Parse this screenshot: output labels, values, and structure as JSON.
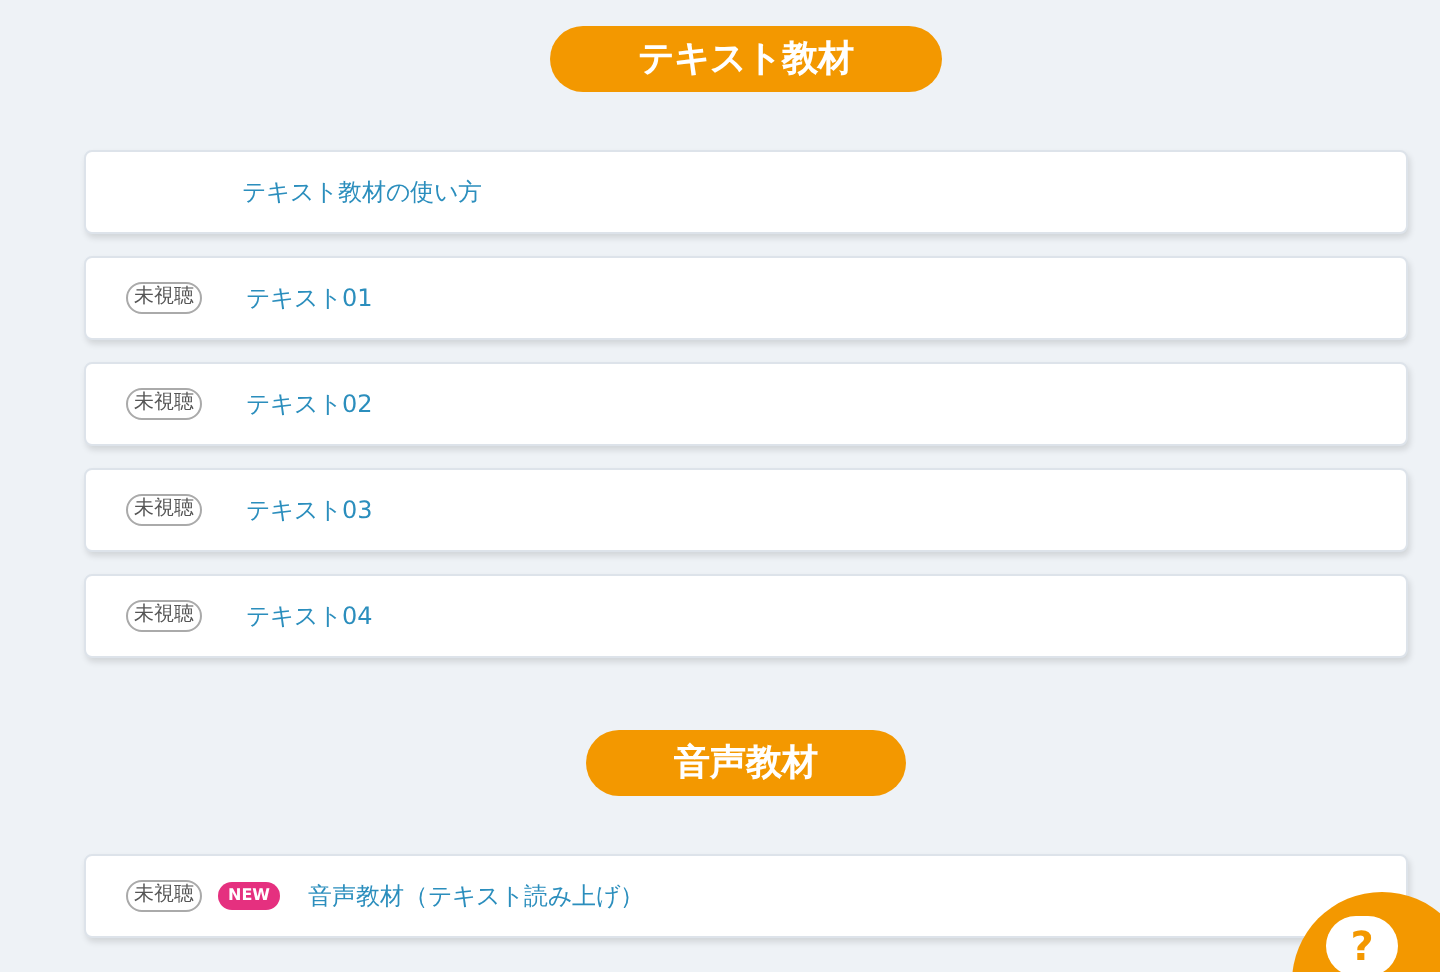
{
  "sections": [
    {
      "title": "テキスト教材",
      "items": [
        {
          "title": "テキスト教材の使い方"
        },
        {
          "status": "未視聴",
          "title": "テキスト01"
        },
        {
          "status": "未視聴",
          "title": "テキスト02"
        },
        {
          "status": "未視聴",
          "title": "テキスト03"
        },
        {
          "status": "未視聴",
          "title": "テキスト04"
        }
      ]
    },
    {
      "title": "音声教材",
      "items": [
        {
          "status": "未視聴",
          "badge": "NEW",
          "title": "音声教材（テキスト読み上げ）"
        }
      ]
    }
  ],
  "help_button": {
    "label": "?"
  }
}
